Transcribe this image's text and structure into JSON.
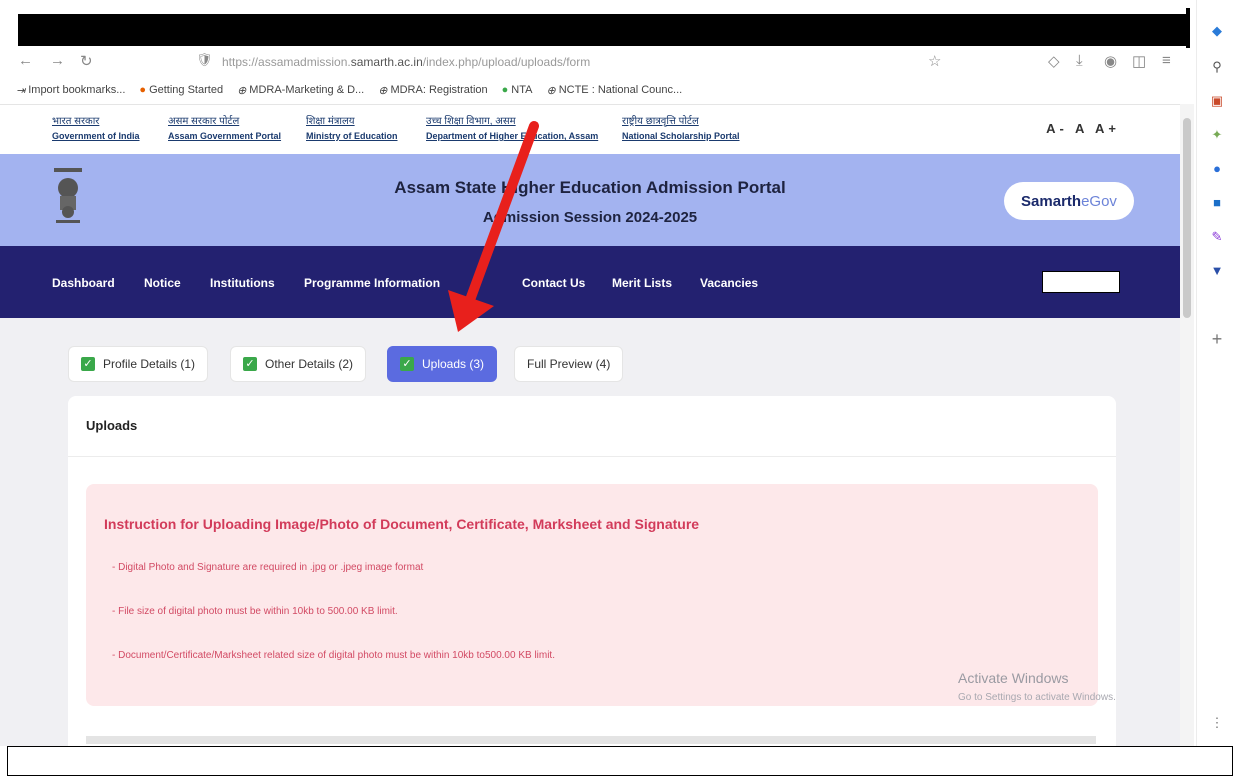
{
  "browser": {
    "url_prefix": "https://assamadmission.",
    "url_domain": "samarth.ac.in",
    "url_path": "/index.php/upload/uploads/form"
  },
  "bookmarks": [
    {
      "label": "Import bookmarks...",
      "icon": "import-icon"
    },
    {
      "label": "Getting Started",
      "icon": "firefox-icon"
    },
    {
      "label": "MDRA-Marketing & D...",
      "icon": "globe-icon"
    },
    {
      "label": "MDRA: Registration",
      "icon": "globe-icon"
    },
    {
      "label": "NTA",
      "icon": "nta-icon"
    },
    {
      "label": "NCTE : National Counc...",
      "icon": "globe-icon"
    }
  ],
  "gov_links": [
    {
      "hi": "भारत सरकार",
      "en": "Government of India"
    },
    {
      "hi": "असम सरकार पोर्टल",
      "en": "Assam Government Portal"
    },
    {
      "hi": "शिक्षा मंत्रालय",
      "en": "Ministry of Education"
    },
    {
      "hi": "उच्च शिक्षा विभाग, असम",
      "en": "Department of Higher Education, Assam"
    },
    {
      "hi": "राष्ट्रीय छात्रवृत्ति पोर्टल",
      "en": "National Scholarship Portal"
    }
  ],
  "font_size_controls": "A- A A+",
  "header": {
    "title": "Assam State Higher Education Admission Portal",
    "subtitle": "Admission Session 2024-2025",
    "brand_strong": "Samarth",
    "brand_light": "eGov"
  },
  "nav": [
    "Dashboard",
    "Notice",
    "Institutions",
    "Programme Information",
    "",
    "Contact Us",
    "Merit Lists",
    "Vacancies"
  ],
  "tabs": [
    {
      "label": "Profile Details  (1)",
      "checked": true,
      "active": false
    },
    {
      "label": "Other Details  (2)",
      "checked": true,
      "active": false
    },
    {
      "label": "Uploads  (3)",
      "checked": true,
      "active": true
    },
    {
      "label": "Full Preview  (4)",
      "checked": false,
      "active": false
    }
  ],
  "card": {
    "title": "Uploads",
    "instruction_heading": "Instruction for Uploading Image/Photo of Document, Certificate, Marksheet and Signature",
    "instructions": [
      "- Digital Photo and Signature are required in .jpg or .jpeg image format",
      "- File size of digital photo must be within 10kb to 500.00 KB limit.",
      "- Document/Certificate/Marksheet related size of digital photo must be within 10kb to500.00 KB limit."
    ]
  },
  "watermark": {
    "line1": "Activate Windows",
    "line2": "Go to Settings to activate Windows."
  },
  "colors": {
    "header_bg": "#a3b3f0",
    "navbar_bg": "#232170",
    "active_tab": "#5b6be0",
    "instruction_bg": "#fde8ea",
    "instruction_text": "#d23b5a",
    "annotation_arrow": "#e8201c"
  }
}
